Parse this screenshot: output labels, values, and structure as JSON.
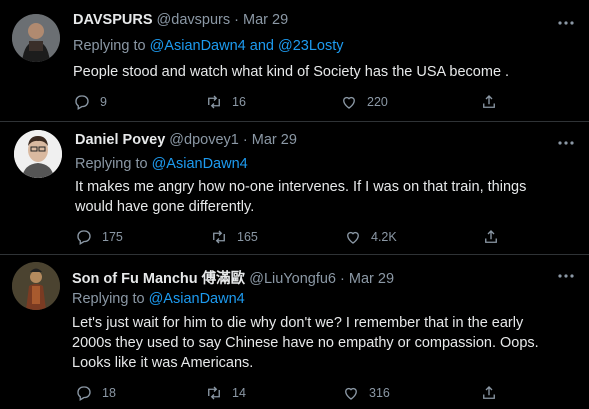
{
  "tweets": [
    {
      "name": "DAVSPURS",
      "handle": "@davspurs",
      "date": "Mar 29",
      "replying_prefix": "Replying to",
      "mention1": "@AsianDawn4",
      "conjunction": "and",
      "mention2": "@23Losty",
      "text": "People stood and watch what kind of Society has the USA become .",
      "replies": "9",
      "retweets": "16",
      "likes": "220"
    },
    {
      "name": "Daniel Povey",
      "handle": "@dpovey1",
      "date": "Mar 29",
      "replying_prefix": "Replying to",
      "mention1": "@AsianDawn4",
      "text_line1": "It makes me angry how no-one intervenes.  If I was on that train, things",
      "text_line2": "would have gone differently.",
      "replies": "175",
      "retweets": "165",
      "likes": "4.2K"
    },
    {
      "name": "Son of Fu Manchu 傅滿歐",
      "handle": "@LiuYongfu6",
      "date": "Mar 29",
      "replying_prefix": "Replying to",
      "mention1": "@AsianDawn4",
      "text_line1": "Let's just wait for him to die why don't we? I remember that in the early",
      "text_line2": "2000s they used to say Chinese have no empathy or compassion. Oops.",
      "text_line3": "Looks like it was Americans.",
      "replies": "18",
      "retweets": "14",
      "likes": "316"
    }
  ],
  "colors": {
    "background": "#000000",
    "text": "#e7e9ea",
    "muted": "#8b98a5",
    "link": "#1d9bf0"
  },
  "icons": [
    "more-icon",
    "reply-icon",
    "retweet-icon",
    "like-icon",
    "share-icon"
  ]
}
